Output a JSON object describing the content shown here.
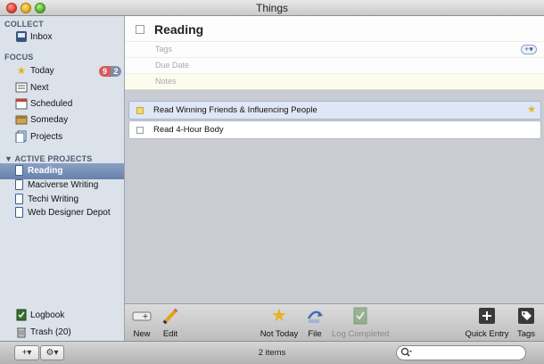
{
  "window": {
    "title": "Things"
  },
  "sidebar": {
    "collect": {
      "header": "COLLECT",
      "items": [
        {
          "label": "Inbox",
          "icon": "inbox-icon"
        }
      ]
    },
    "focus": {
      "header": "FOCUS",
      "items": [
        {
          "label": "Today",
          "icon": "star-icon",
          "badge_red": "9",
          "badge_gray": "2"
        },
        {
          "label": "Next",
          "icon": "next-list-icon"
        },
        {
          "label": "Scheduled",
          "icon": "calendar-icon"
        },
        {
          "label": "Someday",
          "icon": "someday-box-icon"
        },
        {
          "label": "Projects",
          "icon": "projects-icon"
        }
      ]
    },
    "active_projects": {
      "header": "ACTIVE PROJECTS",
      "items": [
        {
          "label": "Reading",
          "selected": true
        },
        {
          "label": "Maciverse Writing"
        },
        {
          "label": "Techi Writing"
        },
        {
          "label": "Web Designer Depot"
        }
      ]
    },
    "bottom": [
      {
        "label": "Logbook",
        "icon": "logbook-icon"
      },
      {
        "label": "Trash (20)",
        "icon": "trash-icon"
      }
    ]
  },
  "project": {
    "title": "Reading",
    "tags_placeholder": "Tags",
    "due_placeholder": "Due Date",
    "notes_placeholder": "Notes",
    "add_tag": "+▾"
  },
  "tasks": [
    {
      "label": "Read Winning Friends & Influencing People",
      "selected": true,
      "starred": true
    },
    {
      "label": "Read 4-Hour Body",
      "selected": false,
      "starred": false
    }
  ],
  "toolbar": {
    "new": "New",
    "edit": "Edit",
    "not_today": "Not Today",
    "file": "File",
    "log_completed": "Log Completed",
    "quick_entry": "Quick Entry",
    "tags": "Tags"
  },
  "bottombar": {
    "add": "+▾",
    "gear": "⚙▾",
    "item_count": "2 items",
    "search_icon": "🔍",
    "search_value": ""
  },
  "colors": {
    "selection": "#6f88b2",
    "badge_red": "#d85a5a",
    "badge_gray": "#7f8ea6"
  }
}
